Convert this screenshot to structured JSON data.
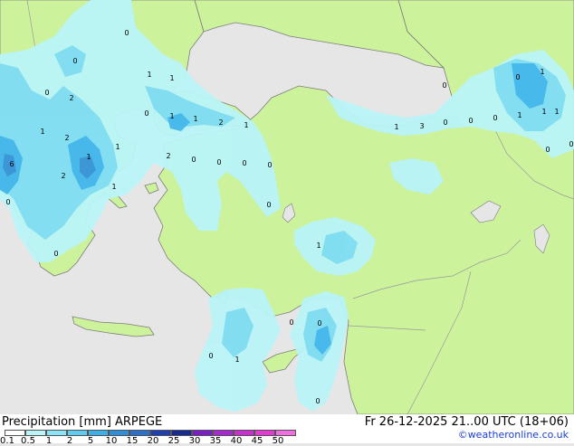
{
  "map": {
    "colors": {
      "sea": "#e6e6e6",
      "land": "#ccf29c",
      "border": "#9a9a9a",
      "coast": "#7d7d7d",
      "precip_light": "#b9f4f8",
      "precip_medium": "#7fdcf0",
      "precip_heavy": "#45b6ea",
      "precip_max": "#3d97d6"
    },
    "labels": [
      "0",
      "0",
      "1",
      "1",
      "0",
      "2",
      "1",
      "1",
      "2",
      "1",
      "0",
      "2",
      "1",
      "2",
      "0",
      "0",
      "0",
      "0",
      "1",
      "1",
      "0",
      "0",
      "0",
      "3",
      "0",
      "0",
      "0",
      "1",
      "1",
      "1",
      "1",
      "1",
      "0",
      "0",
      "1",
      "0",
      "0",
      "0",
      "0",
      "0",
      "1",
      "2",
      "6",
      "1",
      "0"
    ]
  },
  "footer": {
    "legend_title": "Precipitation [mm]  ARPEGE",
    "valid_time": "Fr 26-12-2025 21..00 UTC (18+06)",
    "credit": "©weatheronline.co.uk",
    "scale_labels": [
      "0.1",
      "0.5",
      "1",
      "2",
      "5",
      "10",
      "15",
      "20",
      "25",
      "30",
      "35",
      "40",
      "45",
      "50"
    ],
    "scale_colors": [
      "#fdfdfd",
      "#b9f4f8",
      "#8ae4f5",
      "#5fcdf0",
      "#3eb0e8",
      "#2f8fd8",
      "#2c6fc8",
      "#1f3fae",
      "#162a92",
      "#7a1fc4",
      "#a62ad0",
      "#c92fcf",
      "#e33bd2",
      "#f06fe0"
    ]
  }
}
